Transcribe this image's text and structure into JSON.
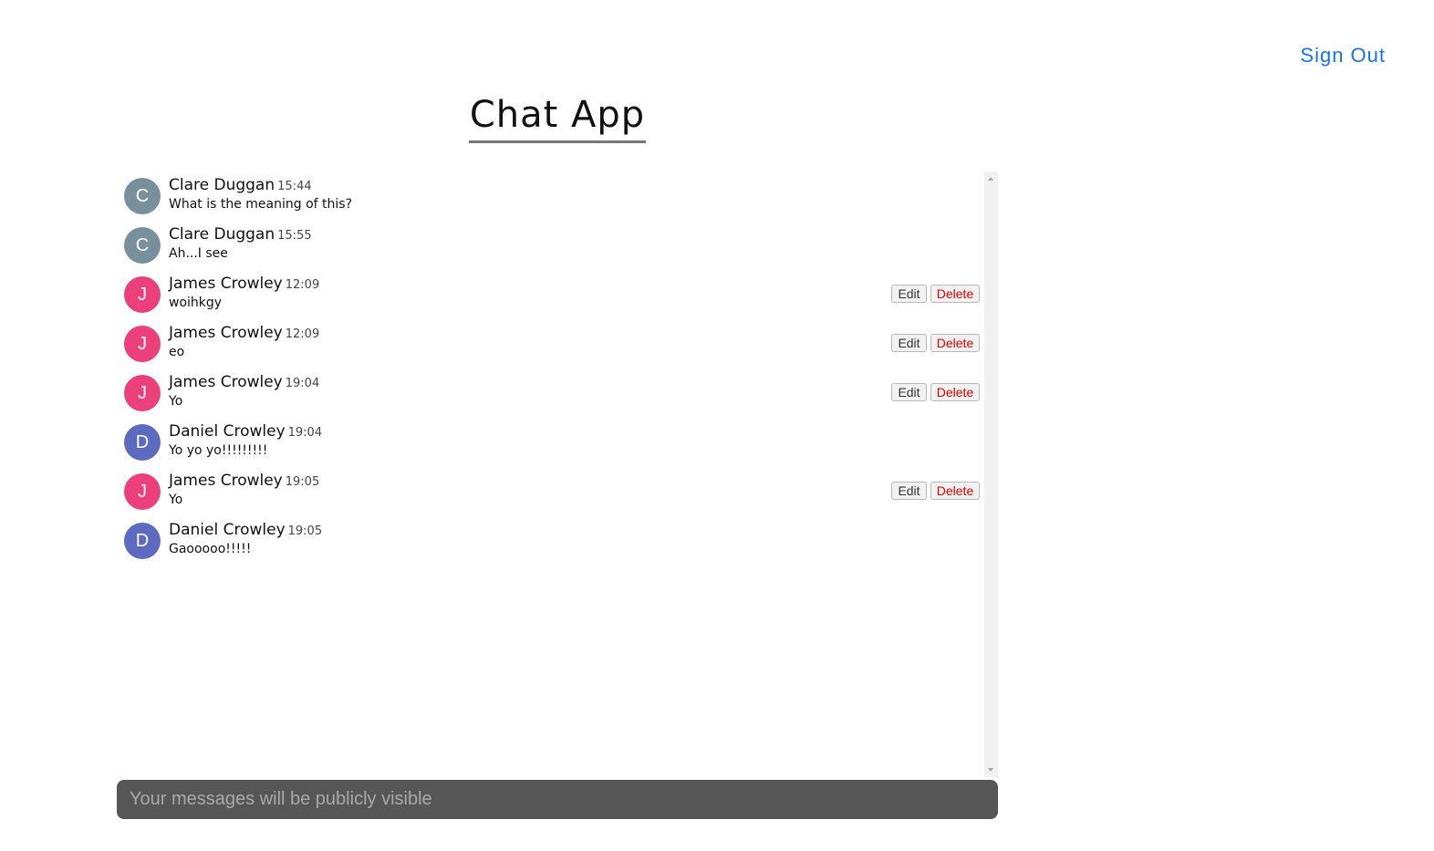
{
  "header": {
    "sign_out_label": "Sign Out",
    "title": "Chat App"
  },
  "colors": {
    "link": "#1a73e8",
    "avatar_c": "#78909c",
    "avatar_j": "#ec407a",
    "avatar_d": "#5c6bc0",
    "delete_text": "#dd0000",
    "composer_bg": "#565656"
  },
  "buttons": {
    "edit_label": "Edit",
    "delete_label": "Delete"
  },
  "messages": [
    {
      "initial": "C",
      "name": "Clare Duggan",
      "time": "15:44",
      "text": "What is the meaning of this?",
      "color": "#78909c",
      "own": false
    },
    {
      "initial": "C",
      "name": "Clare Duggan",
      "time": "15:55",
      "text": "Ah...I see",
      "color": "#78909c",
      "own": false
    },
    {
      "initial": "J",
      "name": "James Crowley",
      "time": "12:09",
      "text": "woihkgy",
      "color": "#ec407a",
      "own": true
    },
    {
      "initial": "J",
      "name": "James Crowley",
      "time": "12:09",
      "text": "eo",
      "color": "#ec407a",
      "own": true
    },
    {
      "initial": "J",
      "name": "James Crowley",
      "time": "19:04",
      "text": "Yo",
      "color": "#ec407a",
      "own": true
    },
    {
      "initial": "D",
      "name": "Daniel Crowley",
      "time": "19:04",
      "text": "Yo yo yo!!!!!!!!!",
      "color": "#5c6bc0",
      "own": false
    },
    {
      "initial": "J",
      "name": "James Crowley",
      "time": "19:05",
      "text": "Yo",
      "color": "#ec407a",
      "own": true
    },
    {
      "initial": "D",
      "name": "Daniel Crowley",
      "time": "19:05",
      "text": "Gaooooo!!!!!",
      "color": "#5c6bc0",
      "own": false
    }
  ],
  "composer": {
    "placeholder": "Your messages will be publicly visible",
    "value": ""
  }
}
